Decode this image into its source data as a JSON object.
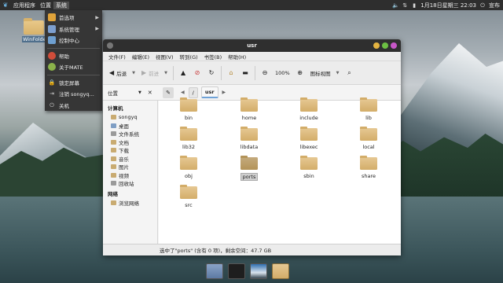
{
  "top_panel": {
    "menus": [
      "应用程序",
      "位置",
      "系统"
    ],
    "clock": "1月18日星期三 22:03",
    "user": "宣布"
  },
  "desktop": {
    "folder_label": "WinFolder"
  },
  "system_menu": {
    "items": [
      {
        "label": "首选项",
        "submenu": true,
        "icon": "preferences-icon",
        "color": "#e0a33a"
      },
      {
        "label": "系统管理",
        "submenu": true,
        "icon": "admin-icon",
        "color": "#7d9fcf"
      },
      {
        "label": "控制中心",
        "submenu": false,
        "icon": "control-center-icon",
        "color": "#6e9fd0"
      },
      {
        "label": "帮助",
        "submenu": false,
        "icon": "help-icon",
        "color": "#d04d3a"
      },
      {
        "label": "关于MATE",
        "submenu": false,
        "icon": "mate-icon",
        "color": "#8bb24a"
      },
      {
        "label": "锁定屏幕",
        "submenu": false,
        "icon": "lock-icon",
        "color": "#aaaaaa"
      },
      {
        "label": "注销 songyq...",
        "submenu": false,
        "icon": "logout-icon",
        "color": "#aaaaaa"
      },
      {
        "label": "关机",
        "submenu": false,
        "icon": "power-icon",
        "color": "#aaaaaa"
      }
    ]
  },
  "window": {
    "title": "usr",
    "menubar": [
      "文件(F)",
      "编辑(E)",
      "视图(V)",
      "转到(G)",
      "书签(B)",
      "帮助(H)"
    ],
    "toolbar": {
      "back": "后退",
      "forward": "前进",
      "zoom": "100%",
      "view_mode": "图标视图"
    },
    "location": {
      "side_label": "位置",
      "crumbs": [
        "/",
        "usr"
      ]
    },
    "sidebar": {
      "sections": [
        {
          "title": "计算机",
          "items": [
            {
              "label": "songyq",
              "kind": "home"
            },
            {
              "label": "桌面",
              "kind": "desktop"
            },
            {
              "label": "文件系统",
              "kind": "drive"
            },
            {
              "label": "文档",
              "kind": "folder"
            },
            {
              "label": "下载",
              "kind": "folder"
            },
            {
              "label": "音乐",
              "kind": "folder"
            },
            {
              "label": "图片",
              "kind": "folder"
            },
            {
              "label": "视频",
              "kind": "folder"
            },
            {
              "label": "回收站",
              "kind": "trash"
            }
          ]
        },
        {
          "title": "网络",
          "items": [
            {
              "label": "浏览网络",
              "kind": "network"
            }
          ]
        }
      ]
    },
    "folders": [
      "bin",
      "home",
      "include",
      "lib",
      "lib32",
      "libdata",
      "libexec",
      "local",
      "obj",
      "ports",
      "sbin",
      "share",
      "src"
    ],
    "selected": "ports",
    "status": "选中了\"ports\" (含有 0 项)，剩余空间：47.7 GB"
  },
  "colors": {
    "panel": "#2e2e2e",
    "selection": "#cfcfcf",
    "folder": "#d8b26a"
  }
}
